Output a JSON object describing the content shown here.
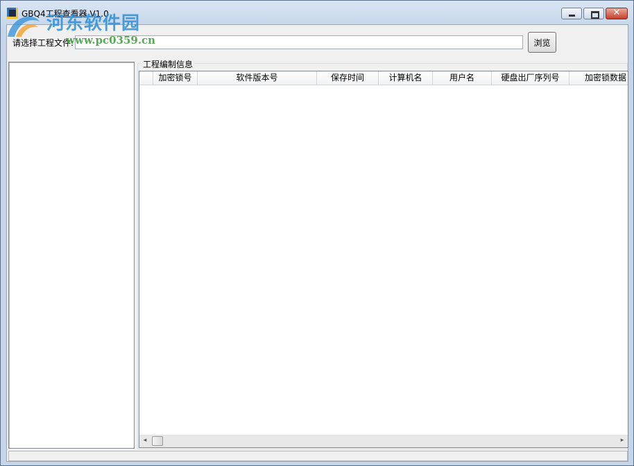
{
  "window": {
    "title": "GBQ4工程查看器 V1.0",
    "buttons": [
      "minimize",
      "maximize",
      "close"
    ]
  },
  "watermark": {
    "site_name": "河东软件园",
    "url": "www.pc0359.cn"
  },
  "file_selector": {
    "label": "请选择工程文件:",
    "value": "",
    "browse_label": "浏览"
  },
  "info_group": {
    "title": "工程编制信息",
    "columns": [
      "",
      "加密锁号",
      "软件版本号",
      "保存时间",
      "计算机名",
      "用户名",
      "硬盘出厂序列号",
      "加密锁数据"
    ],
    "rows": []
  },
  "scrollbar": {
    "left_arrow": "◂",
    "right_arrow": "▸"
  },
  "colors": {
    "title_gradient_top": "#d9e5f3",
    "client_bg": "#f0f0f0",
    "close_button": "#c7402c",
    "watermark_blue": "#2f8fd6",
    "watermark_green": "#3a9a3a"
  }
}
